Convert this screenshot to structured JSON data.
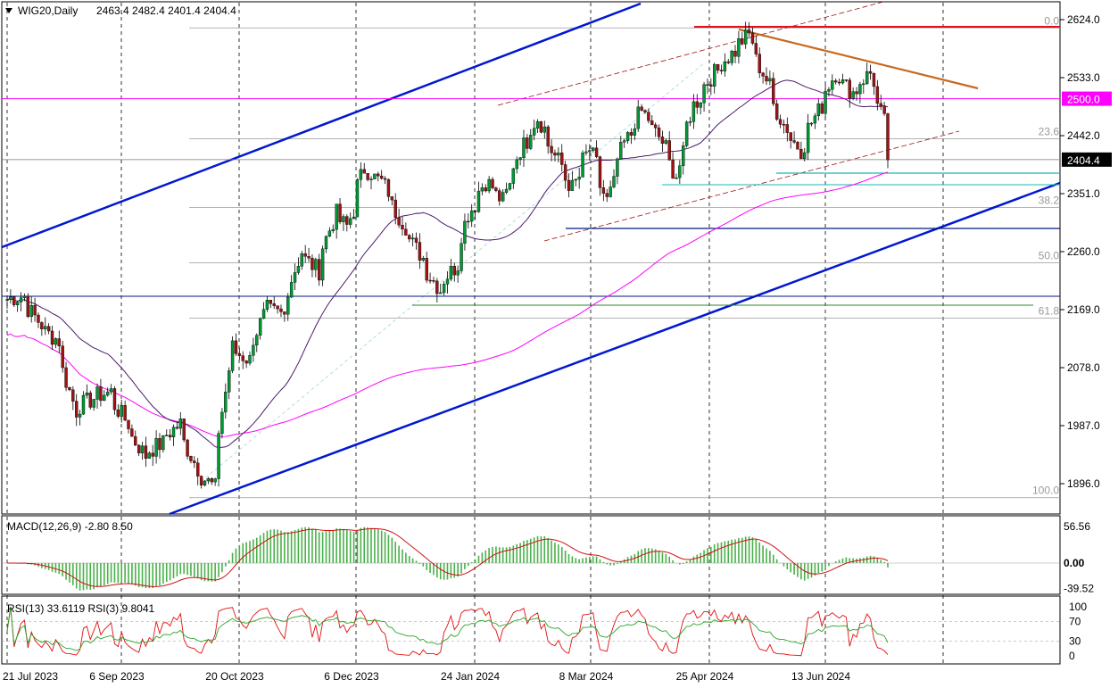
{
  "chart_data": [
    {
      "type": "candlestick",
      "title": "WIG20,Daily",
      "ohlc_text": "2463.4 2482.4 2401.4 2404.4",
      "last_price": "2404.4",
      "y_ticks": [
        "2624.0",
        "2533.0",
        "2442.0",
        "2351.0",
        "2260.0",
        "2169.0",
        "2078.0",
        "1987.0",
        "1896.0"
      ],
      "x_ticks": [
        "21 Jul 2023",
        "6 Sep 2023",
        "20 Oct 2023",
        "6 Dec 2023",
        "24 Jan 2024",
        "8 Mar 2024",
        "25 Apr 2024",
        "13 Jun 2024"
      ],
      "ylim": [
        1870,
        2655
      ],
      "horizontal_level": {
        "value": 2500,
        "label": "2500.0",
        "color": "#ff00ff"
      },
      "fibonacci": {
        "high": 2611,
        "low": 1874,
        "labels": [
          "0.0",
          "23.6",
          "38.2",
          "50.0",
          "61.8",
          "100.0"
        ],
        "ratios": [
          0,
          0.236,
          0.382,
          0.5,
          0.618,
          1.0
        ]
      },
      "colors": {
        "bull": "#009933",
        "bear": "#a11313",
        "channel": "#0018d0",
        "sma": "#ff00ff",
        "ema": "#4b1a6b",
        "trend": "#c8691e",
        "resistance": "#e0101e"
      },
      "candles_sampled": [
        {
          "date": "2023-07-21",
          "c": 2185
        },
        {
          "date": "2023-07-28",
          "c": 2190
        },
        {
          "date": "2023-08-04",
          "c": 2145
        },
        {
          "date": "2023-08-11",
          "c": 2120
        },
        {
          "date": "2023-08-18",
          "c": 2010
        },
        {
          "date": "2023-08-25",
          "c": 2030
        },
        {
          "date": "2023-09-01",
          "c": 2040
        },
        {
          "date": "2023-09-08",
          "c": 1990
        },
        {
          "date": "2023-09-15",
          "c": 1940
        },
        {
          "date": "2023-09-22",
          "c": 1960
        },
        {
          "date": "2023-09-29",
          "c": 1990
        },
        {
          "date": "2023-10-06",
          "c": 1920
        },
        {
          "date": "2023-10-13",
          "c": 1890
        },
        {
          "date": "2023-10-18",
          "c": 2040
        },
        {
          "date": "2023-10-20",
          "c": 2110
        },
        {
          "date": "2023-10-27",
          "c": 2090
        },
        {
          "date": "2023-11-03",
          "c": 2170
        },
        {
          "date": "2023-11-10",
          "c": 2160
        },
        {
          "date": "2023-11-17",
          "c": 2260
        },
        {
          "date": "2023-11-24",
          "c": 2230
        },
        {
          "date": "2023-12-01",
          "c": 2320
        },
        {
          "date": "2023-12-06",
          "c": 2300
        },
        {
          "date": "2023-12-13",
          "c": 2390
        },
        {
          "date": "2023-12-20",
          "c": 2370
        },
        {
          "date": "2023-12-29",
          "c": 2300
        },
        {
          "date": "2024-01-05",
          "c": 2250
        },
        {
          "date": "2024-01-12",
          "c": 2200
        },
        {
          "date": "2024-01-19",
          "c": 2240
        },
        {
          "date": "2024-01-24",
          "c": 2320
        },
        {
          "date": "2024-01-31",
          "c": 2370
        },
        {
          "date": "2024-02-07",
          "c": 2340
        },
        {
          "date": "2024-02-14",
          "c": 2420
        },
        {
          "date": "2024-02-21",
          "c": 2470
        },
        {
          "date": "2024-02-28",
          "c": 2410
        },
        {
          "date": "2024-03-06",
          "c": 2360
        },
        {
          "date": "2024-03-13",
          "c": 2420
        },
        {
          "date": "2024-03-20",
          "c": 2340
        },
        {
          "date": "2024-03-27",
          "c": 2430
        },
        {
          "date": "2024-04-03",
          "c": 2480
        },
        {
          "date": "2024-04-10",
          "c": 2440
        },
        {
          "date": "2024-04-17",
          "c": 2380
        },
        {
          "date": "2024-04-24",
          "c": 2490
        },
        {
          "date": "2024-05-02",
          "c": 2540
        },
        {
          "date": "2024-05-09",
          "c": 2570
        },
        {
          "date": "2024-05-16",
          "c": 2600
        },
        {
          "date": "2024-05-23",
          "c": 2530
        },
        {
          "date": "2024-05-30",
          "c": 2460
        },
        {
          "date": "2024-06-06",
          "c": 2420
        },
        {
          "date": "2024-06-13",
          "c": 2480
        },
        {
          "date": "2024-06-20",
          "c": 2540
        },
        {
          "date": "2024-06-27",
          "c": 2510
        },
        {
          "date": "2024-07-04",
          "c": 2540
        },
        {
          "date": "2024-07-10",
          "c": 2463
        },
        {
          "date": "2024-07-11",
          "c": 2404
        }
      ]
    },
    {
      "type": "histogram",
      "title": "MACD(12,26,9) -2.80 8.50",
      "y_ticks": [
        "56.56",
        "0.00",
        "-39.52"
      ],
      "ylim": [
        -45,
        65
      ]
    },
    {
      "type": "line",
      "title": "RSI(13) 33.6119  RSI(3) 9.8041",
      "y_ticks": [
        "100",
        "70",
        "30",
        "0"
      ],
      "ylim": [
        0,
        100
      ],
      "levels": [
        70,
        30
      ]
    }
  ]
}
